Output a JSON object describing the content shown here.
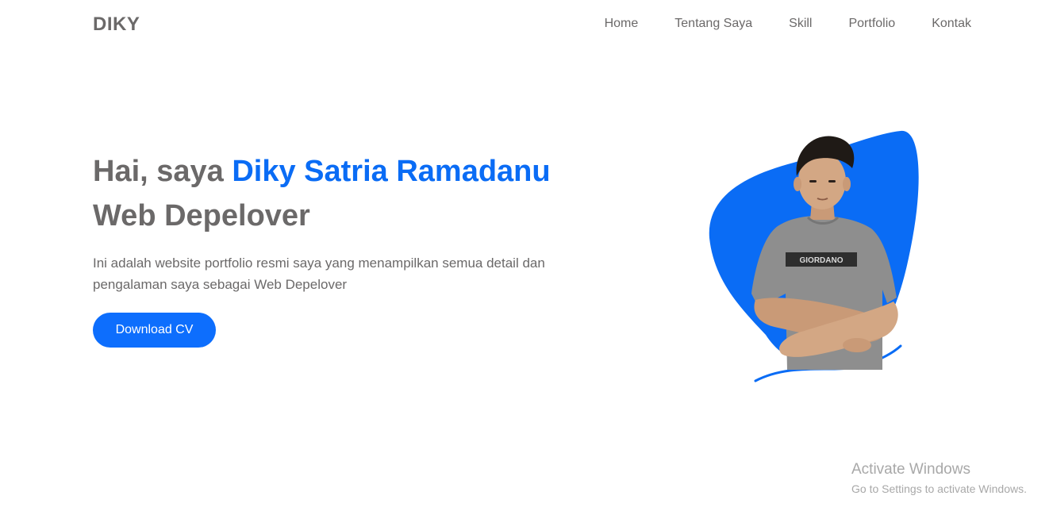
{
  "navbar": {
    "brand": "DIKY",
    "links": [
      "Home",
      "Tentang Saya",
      "Skill",
      "Portfolio",
      "Kontak"
    ]
  },
  "hero": {
    "title_prefix": "Hai, saya ",
    "title_name": "Diky Satria Ramadanu",
    "title_role": "Web Depelover",
    "description": "Ini adalah website portfolio resmi saya yang menampilkan semua detail dan pengalaman saya sebagai Web Depelover",
    "cta_label": "Download CV",
    "shirt_print": "GIORDANO"
  },
  "watermark": {
    "title": "Activate Windows",
    "subtitle": "Go to Settings to activate Windows."
  },
  "colors": {
    "accent": "#0d6efd",
    "text": "#6b6969",
    "background": "#ffffff"
  }
}
